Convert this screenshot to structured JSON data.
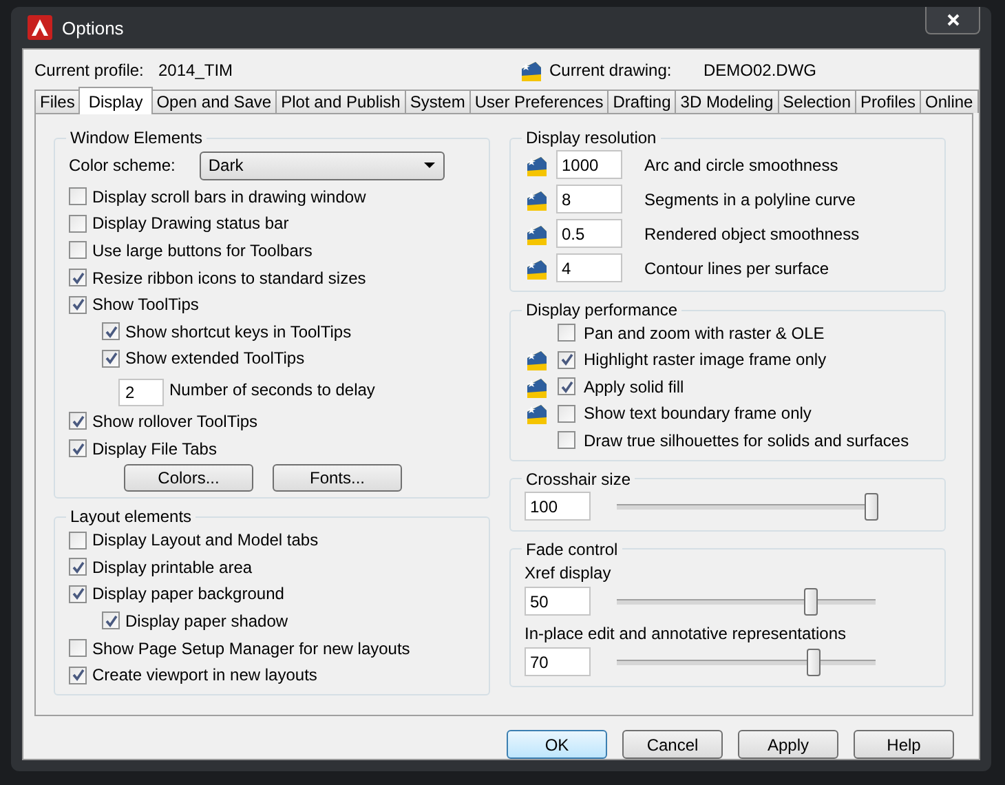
{
  "window": {
    "title": "Options"
  },
  "current_profile": {
    "label": "Current profile:",
    "value": "2014_TIM"
  },
  "current_drawing": {
    "label": "Current drawing:",
    "value": "DEMO02.DWG"
  },
  "tabs": [
    {
      "label": "Files",
      "selected": false
    },
    {
      "label": "Display",
      "selected": true
    },
    {
      "label": "Open and Save",
      "selected": false
    },
    {
      "label": "Plot and Publish",
      "selected": false
    },
    {
      "label": "System",
      "selected": false
    },
    {
      "label": "User Preferences",
      "selected": false
    },
    {
      "label": "Drafting",
      "selected": false
    },
    {
      "label": "3D Modeling",
      "selected": false
    },
    {
      "label": "Selection",
      "selected": false
    },
    {
      "label": "Profiles",
      "selected": false
    },
    {
      "label": "Online",
      "selected": false
    }
  ],
  "window_elements": {
    "title": "Window Elements",
    "color_scheme": {
      "label": "Color scheme:",
      "value": "Dark"
    },
    "items": [
      {
        "kind": "checkbox",
        "label": "Display scroll bars in drawing window",
        "checked": false
      },
      {
        "kind": "checkbox",
        "label": "Display Drawing status bar",
        "checked": false
      },
      {
        "kind": "checkbox",
        "label": "Use large buttons for Toolbars",
        "checked": false
      },
      {
        "kind": "checkbox",
        "label": "Resize ribbon icons to standard sizes",
        "checked": true
      },
      {
        "kind": "checkbox",
        "label": "Show ToolTips",
        "checked": true,
        "children": [
          {
            "kind": "checkbox",
            "label": "Show shortcut keys in ToolTips",
            "checked": true
          },
          {
            "kind": "checkbox",
            "label": "Show extended ToolTips",
            "checked": true,
            "children": [
              {
                "kind": "number",
                "value": "2",
                "label": "Number of seconds to delay"
              }
            ]
          }
        ]
      },
      {
        "kind": "checkbox",
        "label": "Show rollover ToolTips",
        "checked": true
      },
      {
        "kind": "checkbox",
        "label": "Display File Tabs",
        "checked": true
      }
    ],
    "buttons": [
      "Colors...",
      "Fonts..."
    ]
  },
  "layout_elements": {
    "title": "Layout elements",
    "items": [
      {
        "kind": "checkbox",
        "label": "Display Layout and Model tabs",
        "checked": false
      },
      {
        "kind": "checkbox",
        "label": "Display printable area",
        "checked": true
      },
      {
        "kind": "checkbox",
        "label": "Display paper background",
        "checked": true,
        "children": [
          {
            "kind": "checkbox",
            "label": "Display paper shadow",
            "checked": true
          }
        ]
      },
      {
        "kind": "checkbox",
        "label": "Show Page Setup Manager for new layouts",
        "checked": false
      },
      {
        "kind": "checkbox",
        "label": "Create viewport in new layouts",
        "checked": true
      }
    ]
  },
  "display_resolution": {
    "title": "Display resolution",
    "rows": [
      {
        "value": "1000",
        "label": "Arc and circle smoothness"
      },
      {
        "value": "8",
        "label": "Segments in a polyline curve"
      },
      {
        "value": "0.5",
        "label": "Rendered object smoothness"
      },
      {
        "value": "4",
        "label": "Contour lines per surface"
      }
    ]
  },
  "display_performance": {
    "title": "Display performance",
    "items": [
      {
        "label": "Pan and zoom with raster & OLE",
        "checked": false,
        "saved_in_drawing": false
      },
      {
        "label": "Highlight raster image frame only",
        "checked": true,
        "saved_in_drawing": true
      },
      {
        "label": "Apply solid fill",
        "checked": true,
        "saved_in_drawing": true
      },
      {
        "label": "Show text boundary frame only",
        "checked": false,
        "saved_in_drawing": true
      },
      {
        "label": "Draw true silhouettes for solids and surfaces",
        "checked": false,
        "saved_in_drawing": false
      }
    ]
  },
  "crosshair_size": {
    "title": "Crosshair size",
    "value": "100",
    "level": 1.0
  },
  "fade_control": {
    "title": "Fade control",
    "sliders": [
      {
        "label": "Xref display",
        "value": "50",
        "level": 0.76
      },
      {
        "label": "In-place edit and annotative representations",
        "value": "70",
        "level": 0.77
      }
    ]
  },
  "buttons": [
    {
      "label": "OK",
      "default": true
    },
    {
      "label": "Cancel",
      "default": false
    },
    {
      "label": "Apply",
      "default": false
    },
    {
      "label": "Help",
      "default": false
    }
  ]
}
